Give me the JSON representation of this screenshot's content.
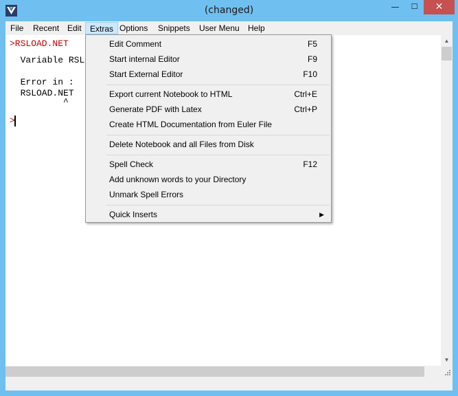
{
  "window": {
    "title": "(changed)",
    "minimize_glyph": "—",
    "maximize_glyph": "☐",
    "close_glyph": "✕"
  },
  "menubar": {
    "items": [
      {
        "label": "File"
      },
      {
        "label": "Recent"
      },
      {
        "label": "Edit"
      },
      {
        "label": "Extras"
      },
      {
        "label": "Options"
      },
      {
        "label": "Snippets"
      },
      {
        "label": "User Menu"
      },
      {
        "label": "Help"
      }
    ]
  },
  "editor": {
    "line1": ">RSLOAD.NET",
    "line2": "  Variable RSL",
    "line3": "  Error in :",
    "line4": "  RSLOAD.NET",
    "line5": "          ^",
    "prompt": ">"
  },
  "extras_menu": {
    "items": [
      {
        "label": "Edit Comment",
        "shortcut": "F5"
      },
      {
        "label": "Start internal Editor",
        "shortcut": "F9"
      },
      {
        "label": "Start External Editor",
        "shortcut": "F10"
      },
      {
        "label": "Export current Notebook to HTML",
        "shortcut": "Ctrl+E"
      },
      {
        "label": "Generate PDF with Latex",
        "shortcut": "Ctrl+P"
      },
      {
        "label": "Create HTML Documentation from Euler File",
        "shortcut": ""
      },
      {
        "label": "Delete Notebook and all Files from Disk",
        "shortcut": ""
      },
      {
        "label": "Spell Check",
        "shortcut": "F12"
      },
      {
        "label": "Add unknown words to your Directory",
        "shortcut": ""
      },
      {
        "label": "Unmark Spell Errors",
        "shortcut": ""
      },
      {
        "label": "Quick Inserts",
        "shortcut": "",
        "submenu_arrow": "▶"
      }
    ]
  },
  "scrollbar": {
    "up_arrow": "▲",
    "down_arrow": "▼",
    "grip_glyph": "⋰"
  },
  "colors": {
    "titlebar": "#6fc0f0",
    "close_button": "#c75050",
    "prompt_text": "#c00000",
    "menu_highlight": "#cce8ff"
  }
}
